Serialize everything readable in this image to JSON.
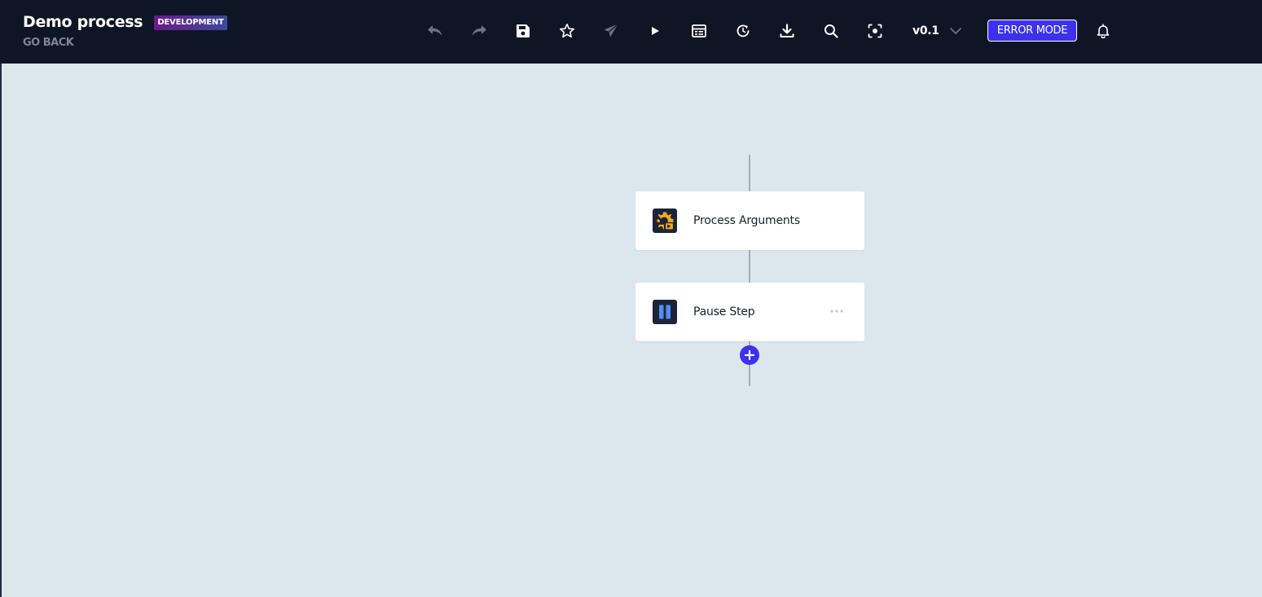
{
  "header": {
    "title": "Demo process",
    "badge": "DEVELOPMENT",
    "go_back": "GO BACK",
    "version": "v0.1",
    "error_mode": "ERROR MODE"
  },
  "toolbar": [
    {
      "name": "undo-icon",
      "enabled": false
    },
    {
      "name": "redo-icon",
      "enabled": false
    },
    {
      "name": "save-icon",
      "enabled": true
    },
    {
      "name": "star-icon",
      "enabled": true
    },
    {
      "name": "send-icon",
      "enabled": false
    },
    {
      "name": "play-icon",
      "enabled": true
    },
    {
      "name": "table-icon",
      "enabled": true
    },
    {
      "name": "history-icon",
      "enabled": true
    },
    {
      "name": "download-icon",
      "enabled": true
    },
    {
      "name": "search-icon",
      "enabled": true
    },
    {
      "name": "focus-icon",
      "enabled": true
    },
    {
      "name": "bell-icon",
      "enabled": true
    }
  ],
  "flow": {
    "steps": [
      {
        "label": "Process Arguments",
        "icon": "gear-icon",
        "icon_color": "#f5a623"
      },
      {
        "label": "Pause Step",
        "icon": "pause-icon",
        "icon_color": "#4f8ef7"
      }
    ]
  },
  "colors": {
    "header_bg": "#0e1626",
    "canvas_bg": "#dce6ed",
    "accent": "#3d30ee",
    "connector": "#a7adb5"
  }
}
